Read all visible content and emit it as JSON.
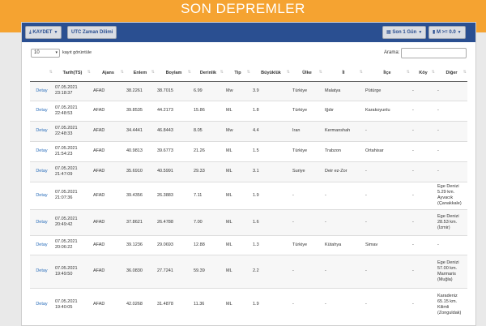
{
  "header": {
    "title": "SON DEPREMLER"
  },
  "toolbar": {
    "save_label": "KAYDET",
    "utc_label": "UTC Zaman Dilimi",
    "last_label": "Son 1 Gün",
    "mag_label": "M >= 0.0"
  },
  "controls": {
    "page_length": "10",
    "page_length_label": "kayıt görüntüle",
    "search_label": "Arama:"
  },
  "table": {
    "headers": [
      "",
      "Tarih(TS)",
      "Ajans",
      "Enlem",
      "Boylam",
      "Derinlik",
      "Tip",
      "Büyüklük",
      "Ülke",
      "İl",
      "İlçe",
      "Köy",
      "Diğer"
    ],
    "rows": [
      [
        "Detay",
        "07.05.2021 23:18:37",
        "AFAD",
        "38.2261",
        "38.7015",
        "6.99",
        "Mw",
        "3.9",
        "Türkiye",
        "Malatya",
        "Pütürge",
        "-",
        "-"
      ],
      [
        "Detay",
        "07.05.2021 22:48:53",
        "AFAD",
        "39.8535",
        "44.2173",
        "15.86",
        "ML",
        "1.8",
        "Türkiye",
        "Iğdır",
        "Karakoyunlu",
        "-",
        "-"
      ],
      [
        "Detay",
        "07.05.2021 22:48:33",
        "AFAD",
        "34.4441",
        "46.8443",
        "8.05",
        "Mw",
        "4.4",
        "Iran",
        "Kermanshah",
        "-",
        "-",
        "-"
      ],
      [
        "Detay",
        "07.05.2021 21:54:23",
        "AFAD",
        "40.9813",
        "39.6773",
        "21.26",
        "ML",
        "1.5",
        "Türkiye",
        "Trabzon",
        "Ortahisar",
        "-",
        "-"
      ],
      [
        "Detay",
        "07.05.2021 21:47:09",
        "AFAD",
        "35.6910",
        "40.5991",
        "29.33",
        "ML",
        "3.1",
        "Suriye",
        "Deir ez-Zor",
        "-",
        "-",
        "-"
      ],
      [
        "Detay",
        "07.05.2021 21:07:36",
        "AFAD",
        "39.4356",
        "26.3883",
        "7.11",
        "ML",
        "1.9",
        "-",
        "-",
        "-",
        "-",
        "Ege Denizi 5.29 km. Ayvacık (Çanakkale)"
      ],
      [
        "Detay",
        "07.05.2021 20:49:42",
        "AFAD",
        "37.8621",
        "26.4788",
        "7.00",
        "ML",
        "1.6",
        "-",
        "-",
        "-",
        "-",
        "Ege Denizi 28.53 km. (İzmir)"
      ],
      [
        "Detay",
        "07.05.2021 20:06:22",
        "AFAD",
        "39.1236",
        "29.0693",
        "12.88",
        "ML",
        "1.3",
        "Türkiye",
        "Kütahya",
        "Simav",
        "-",
        "-"
      ],
      [
        "Detay",
        "07.05.2021 19:49:50",
        "AFAD",
        "36.0830",
        "27.7241",
        "59.39",
        "ML",
        "2.2",
        "-",
        "-",
        "-",
        "-",
        "Ege Denizi 57.00 km. Marmaris (Muğla)"
      ],
      [
        "Detay",
        "07.05.2021 19:40:05",
        "AFAD",
        "42.0268",
        "31.4878",
        "11.36",
        "ML",
        "1.9",
        "-",
        "-",
        "-",
        "-",
        "Karadeniz 65.15 km. Kilimli (Zonguldak)"
      ]
    ]
  }
}
